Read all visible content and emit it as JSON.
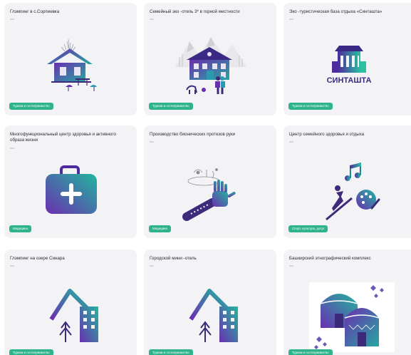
{
  "cards": [
    {
      "title": "Глэмпинг в с.Сорпиевка",
      "sub": "ооо",
      "tag": "Туризм и гостеприимство",
      "icon": "glamping-house-icon"
    },
    {
      "title": "Семейный эко -отель 3* в горной местности",
      "sub": "ооо",
      "tag": "Туризм и гостеприимство",
      "icon": "mountain-eco-hotel-icon"
    },
    {
      "title": "Эко -туристическая база отдыха «Синташта»",
      "sub": "ооо",
      "tag": "Туризм и гостеприимство",
      "icon": "sintashta-logo-icon",
      "logo_text": "СИНТАШТА"
    },
    {
      "title": "Многофункциональный центр здоровья и активного образа жизни",
      "sub": "ооо",
      "tag": "Медицина",
      "icon": "medical-kit-icon"
    },
    {
      "title": "Производство бионических протезов руки",
      "sub": "ооо",
      "tag": "Медицина",
      "icon": "bionic-hand-icon"
    },
    {
      "title": "Центр семейного здоровья и отдыха",
      "sub": "ооо",
      "tag": "Спорт, культура, досуг",
      "icon": "sport-culture-icon"
    },
    {
      "title": "Глэмпинг на озере Синара",
      "sub": "ооо",
      "tag": "Туризм и гостеприимство",
      "icon": "mountain-hotel-icon"
    },
    {
      "title": "Городской мини -отель",
      "sub": "ооо",
      "tag": "Туризм и гостеприимство",
      "icon": "mountain-hotel-icon"
    },
    {
      "title": "Башкирский этнографический комплекс",
      "sub": "ооо",
      "tag": "Туризм и гостеприимство",
      "icon": "yurt-icon"
    }
  ],
  "colors": {
    "card_bg": "#f3f3f5",
    "badge": "#2eb38b",
    "grad_start": "#5a2ea6",
    "grad_end": "#28b99a"
  }
}
